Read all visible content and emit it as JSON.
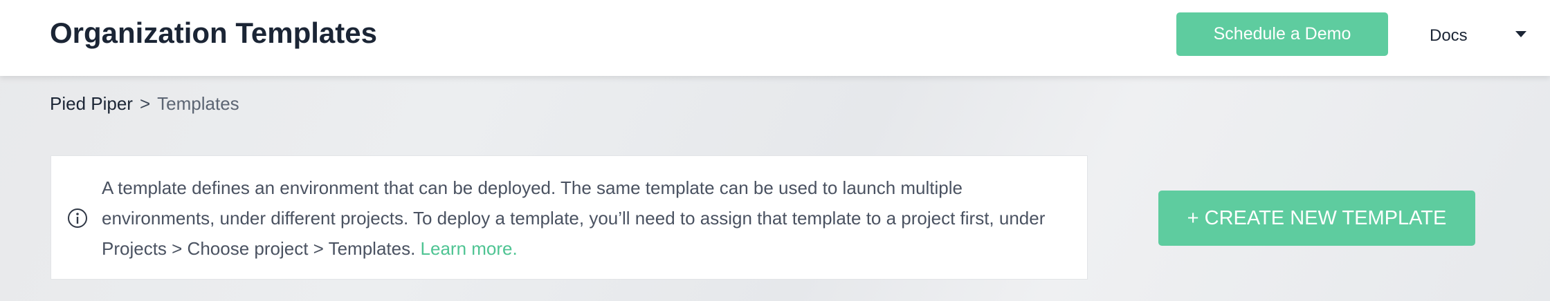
{
  "header": {
    "title": "Organization Templates",
    "schedule_demo_label": "Schedule a Demo",
    "docs_label": "Docs",
    "dropdown_icon": "caret-down-icon"
  },
  "breadcrumb": {
    "organization": "Pied Piper",
    "separator": ">",
    "current": "Templates"
  },
  "info": {
    "icon": "info-circle-icon",
    "text": "A template defines an environment that can be deployed. The same template can be used to launch multiple environments, under different projects. To deploy a template, you’ll need to assign that template to a project first, under Projects > Choose project > Templates.",
    "link_label": "Learn more."
  },
  "actions": {
    "create_template_label": "+ CREATE NEW TEMPLATE"
  },
  "colors": {
    "accent": "#5ecc9f",
    "link": "#4fc493",
    "title_text": "#1b2535",
    "body_text": "#4a5261",
    "background": "#eceef0",
    "card_background": "#ffffff"
  }
}
